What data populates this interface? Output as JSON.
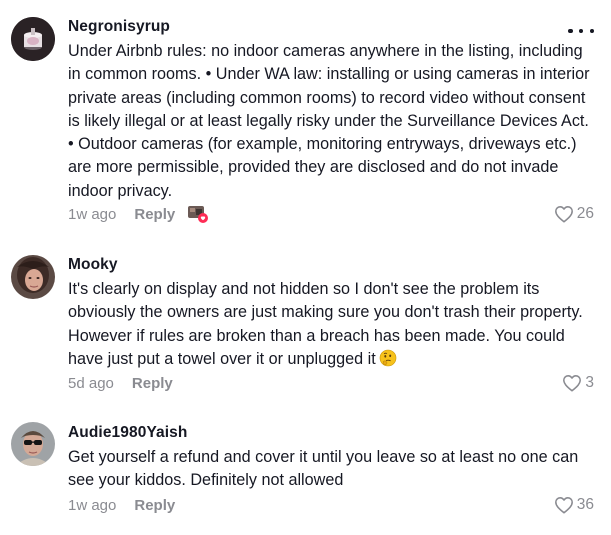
{
  "comments": [
    {
      "username": "Negronisyrup",
      "text": "Under Airbnb rules: no indoor cameras anywhere in the listing, including in common rooms. • Under WA law: installing or using cameras in interior private areas (including common rooms) to record video without consent is likely illegal or at least legally risky under the Surveillance Devices Act. • Outdoor cameras (for example, monitoring entryways, driveways etc.) are more permissible, provided they are disclosed and do not invade indoor privacy.",
      "time": "1w ago",
      "reply": "Reply",
      "likes": "26"
    },
    {
      "username": "Mooky",
      "text": "It's clearly on display and not hidden so I don't see the problem its obviously the owners are just making sure you don't trash their property. However if rules are broken than a breach has been made. You could have just put a towel over it or unplugged it",
      "emoji": "thinking-face",
      "time": "5d ago",
      "reply": "Reply",
      "likes": "3"
    },
    {
      "username": "Audie1980Yaish",
      "text": "Get yourself a refund and cover it until you leave so at least no one can see your kiddos. Definitely not allowed",
      "time": "1w ago",
      "reply": "Reply",
      "likes": "36"
    }
  ],
  "icons": {
    "more": "more-options-icon",
    "like": "heart-outline-icon",
    "creator_liked": "creator-liked-sticker-icon"
  },
  "colors": {
    "text": "#161823",
    "muted": "#8a8b91",
    "badge": "#fe2c55"
  }
}
